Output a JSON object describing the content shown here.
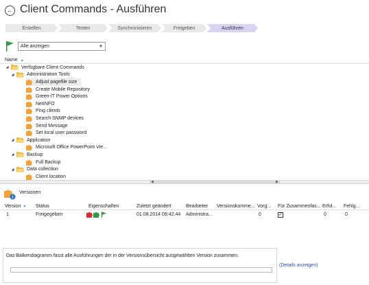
{
  "header": {
    "title": "Client Commands - Ausführen",
    "back_icon": "back-arrow-icon"
  },
  "wizard": {
    "steps": [
      {
        "label": "Erstellen",
        "active": false
      },
      {
        "label": "Testen",
        "active": false
      },
      {
        "label": "Synchronisieren",
        "active": false
      },
      {
        "label": "Freigeben",
        "active": false
      },
      {
        "label": "Ausführen",
        "active": true
      }
    ],
    "active_color": "#d8d4f3"
  },
  "filter": {
    "icon": "flag-icon",
    "selected": "Alle anzeigen"
  },
  "tree": {
    "column_header": "Name",
    "nodes": [
      {
        "label": "Verfügbare Client Commands",
        "type": "folder"
      },
      {
        "label": "Administration Tools",
        "type": "folder"
      },
      {
        "label": "Adjust pagefile size",
        "type": "command",
        "selected": true
      },
      {
        "label": "Create Mobile Repository",
        "type": "command"
      },
      {
        "label": "Green-IT Power Options",
        "type": "command"
      },
      {
        "label": "NetINFO",
        "type": "command"
      },
      {
        "label": "Ping clients",
        "type": "command"
      },
      {
        "label": "Search SNMP devices",
        "type": "command"
      },
      {
        "label": "Send Message",
        "type": "command"
      },
      {
        "label": "Set local user password",
        "type": "command"
      },
      {
        "label": "Application",
        "type": "folder"
      },
      {
        "label": "Microsoft Office PowerPoint Vie...",
        "type": "command"
      },
      {
        "label": "Backup",
        "type": "folder"
      },
      {
        "label": "Full Backup",
        "type": "command"
      },
      {
        "label": "Data collection",
        "type": "folder"
      },
      {
        "label": "Client location",
        "type": "command"
      }
    ]
  },
  "versions": {
    "label": "Versionen",
    "columns": [
      "Version",
      "Status",
      "Eigenschaften",
      "Zuletzt geändert",
      "Bearbeiter",
      "Versionskomme...",
      "Vorg...",
      "Für Zusammenfas...",
      "Erfol...",
      "Fehlg..."
    ],
    "rows": [
      {
        "version": "1",
        "status": "Freigegeben",
        "modified": "01.08.2014 09:42:44",
        "editor": "Administra...",
        "comment": "",
        "vorg": "0",
        "summary_checked": true,
        "erfolg": "0",
        "fehlg": "0"
      }
    ]
  },
  "chart_panel": {
    "text": "Das Balkendiagramm fasst alle Ausführungen der in der Versionsübersicht ausgewählten Version zusammen."
  },
  "details_link": "(Details anzeigen)",
  "colors": {
    "folder": "#e9b94a",
    "puzzle": "#f0a33a",
    "link": "#1f4e99",
    "sort_arrow": "#4a7ec8"
  }
}
